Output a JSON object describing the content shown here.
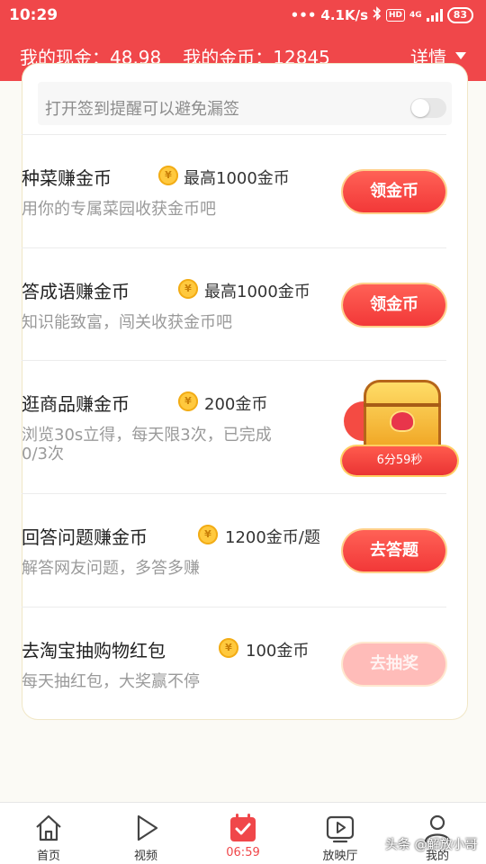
{
  "status_bar": {
    "time": "10:29",
    "net_speed": "4.1K/s",
    "network_type": "4G",
    "battery": "83"
  },
  "header": {
    "cash_label": "我的现金：48.98",
    "coins_label": "我的金币：12845",
    "detail_label": "详情"
  },
  "reminder": {
    "text": "打开签到提醒可以避免漏签",
    "toggle_on": false
  },
  "coin_glyph": "¥",
  "tasks": [
    {
      "title": "种菜赚金币",
      "reward": "最高1000金币",
      "desc": "用你的专属菜园收获金币吧",
      "button": "领金币"
    },
    {
      "title": "答成语赚金币",
      "reward": "最高1000金币",
      "desc": "知识能致富，闯关收获金币吧",
      "button": "领金币"
    },
    {
      "title": "逛商品赚金币",
      "reward": "200金币",
      "desc": "浏览30s立得，每天限3次，已完成0/3次",
      "timer": "6分59秒"
    },
    {
      "title": "回答问题赚金币",
      "reward": "1200金币/题",
      "desc": "解答网友问题，多答多赚",
      "button": "去答题"
    },
    {
      "title": "去淘宝抽购物红包",
      "reward": "100金币",
      "desc": "每天抽红包，大奖赢不停",
      "button": "去抽奖"
    }
  ],
  "bottom_nav": [
    {
      "label": "首页",
      "icon": "home-icon"
    },
    {
      "label": "视频",
      "icon": "play-icon"
    },
    {
      "label": "06:59",
      "icon": "calendar-check-icon",
      "active": true
    },
    {
      "label": "放映厅",
      "icon": "tv-play-icon"
    },
    {
      "label": "我的",
      "icon": "user-icon"
    }
  ],
  "watermark": "头条 @解放小哥",
  "colors": {
    "brand_red": "#f0474a",
    "button_red": "#f23838",
    "disabled_button": "#ffbcb9",
    "coin_gold": "#ffc93e"
  }
}
